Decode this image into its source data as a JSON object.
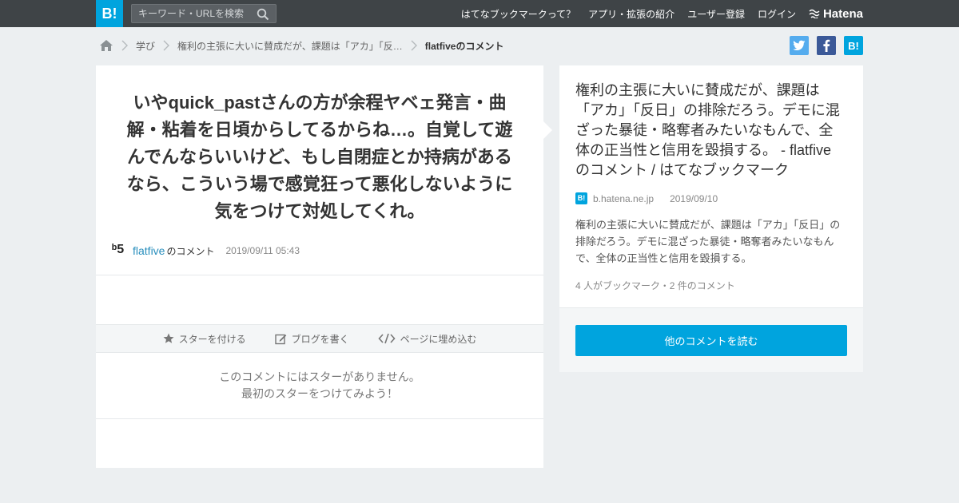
{
  "header": {
    "logo": "B!",
    "search_placeholder": "キーワード・URLを検索",
    "nav": [
      "はてなブックマークって？",
      "アプリ・拡張の紹介",
      "ユーザー登録",
      "ログイン"
    ],
    "brand": "Hatena"
  },
  "breadcrumb": {
    "items": [
      "学び",
      "権利の主張に大いに賛成だが、課題は「アカ」「反…"
    ],
    "current": "flatfiveのコメント"
  },
  "share": {
    "twitter": "t",
    "facebook": "f",
    "hatena": "B!"
  },
  "comment": {
    "text": "いやquick_pastさんの方が余程ヤベェ発言・曲解・粘着を日頃からしてるからね…。自覚して遊んでんならいいけど、もし自閉症とか持病があるなら、こういう場で感覚狂って悪化しないように気をつけて対処してくれ。",
    "avatar": "ᵇ5",
    "user": "flatfive",
    "user_suffix": "のコメント",
    "date": "2019/09/11 05:43"
  },
  "actions": {
    "star": "スターを付ける",
    "blog": "ブログを書く",
    "embed": "ページに埋め込む"
  },
  "no_star": {
    "line1": "このコメントにはスターがありません。",
    "line2": "最初のスターをつけてみよう！"
  },
  "entry": {
    "title": "権利の主張に大いに賛成だが、課題は「アカ」「反日」の排除だろう。デモに混ざった暴徒・略奪者みたいなもんで、全体の正当性と信用を毀損する。 - flatfive のコメント / はてなブックマーク",
    "favicon": "B!",
    "domain": "b.hatena.ne.jp",
    "date": "2019/09/10",
    "description": "権利の主張に大いに賛成だが、課題は「アカ」「反日」の排除だろう。デモに混ざった暴徒・略奪者みたいなもんで、全体の正当性と信用を毀損する。",
    "count": "4 人がブックマーク・2 件のコメント",
    "read_more": "他のコメントを読む"
  },
  "colors": {
    "brand": "#00a4de",
    "header_bg": "#3f4447",
    "twitter": "#55acee",
    "facebook": "#3b5998",
    "link": "#2a8fbd"
  }
}
